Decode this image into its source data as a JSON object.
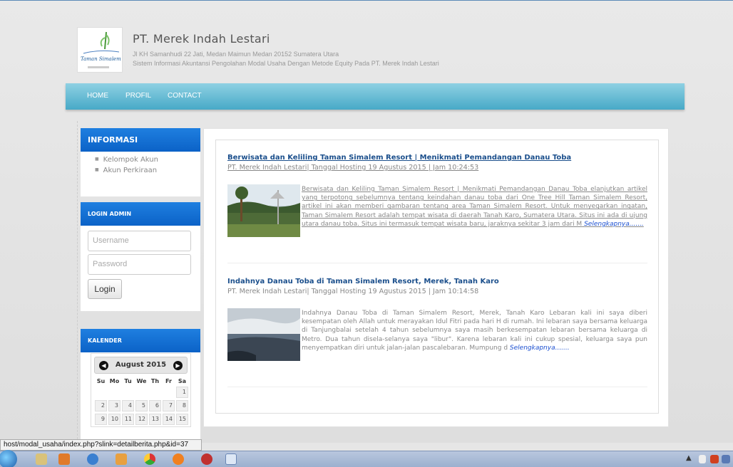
{
  "header": {
    "title": "PT. Merek Indah Lestari",
    "address": "Jl KH Samanhudi 22 Jati, Medan Maimun Medan 20152 Sumatera Utara",
    "description": "Sistem Informasi Akuntansi Pengolahan Modal Usaha Dengan Metode Equity Pada PT. Merek Indah Lestari",
    "logo_text": "Taman Simalem Resort"
  },
  "nav": {
    "items": [
      "HOME",
      "PROFIL",
      "CONTACT"
    ]
  },
  "sidebar": {
    "informasi": {
      "title": "INFORMASI",
      "items": [
        "Kelompok Akun",
        "Akun Perkiraan"
      ]
    },
    "login": {
      "title": "LOGIN ADMIN",
      "username_placeholder": "Username",
      "password_placeholder": "Password",
      "button": "Login"
    },
    "kalender": {
      "title": "KALENDER",
      "month": "August 2015",
      "weekdays": [
        "Su",
        "Mo",
        "Tu",
        "We",
        "Th",
        "Fr",
        "Sa"
      ],
      "week1": [
        "1"
      ],
      "week2": [
        "2",
        "3",
        "4",
        "5",
        "6",
        "7",
        "8"
      ],
      "week3": [
        "9",
        "10",
        "11",
        "12",
        "13",
        "14",
        "15"
      ]
    }
  },
  "articles": [
    {
      "title": "Berwisata dan Keliling Taman Simalem Resort | Menikmati Pemandangan Danau Toba",
      "meta": "PT. Merek Indah Lestari| Tanggal Hosting 19 Agustus 2015 | Jam 10:24:53",
      "body": "Berwisata dan Keliling Taman Simalem Resort | Menikmati Pemandangan Danau Toba elanjutkan artikel yang terpotong sebelumnya tentang keindahan danau toba dari One Tree Hill Taman Simalem Resort, artikel ini akan memberi gambaran tentang area Taman Simalem Resort. Untuk menyegarkan ingatan, Taman Simalem Resort adalah tempat wisata di daerah Tanah Karo, Sumatera Utara. Situs ini ada di ujung utara danau toba. Situs ini termasuk tempat wisata baru, jaraknya sekitar 3 jam dari M",
      "more": "Selengkapnya......."
    },
    {
      "title": "Indahnya Danau Toba di Taman Simalem Resort, Merek, Tanah Karo",
      "meta": "PT. Merek Indah Lestari| Tanggal Hosting 19 Agustus 2015 | Jam 10:14:58",
      "body": "Indahnya Danau Toba di Taman Simalem Resort, Merek, Tanah Karo Lebaran kali ini saya diberi kesempatan oleh Allah untuk merayakan Idul Fitri pada hari H di rumah. Ini lebaran saya bersama keluarga di Tanjungbalai setelah 4 tahun sebelumnya saya masih berkesempatan lebaran bersama keluarga di Metro. Dua tahun disela-selanya saya \"libur\". Karena lebaran kali ini cukup spesial, keluarga saya pun menyempatkan diri untuk jalan-jalan pascalebaran. Mumpung d",
      "more": "Selengkapnya......."
    }
  ],
  "status_bar": "host/modal_usaha/index.php?slink=detailberita.php&id=37",
  "colors": {
    "nav": "#5fb8d4",
    "sidebar_head": "#1070d8",
    "link": "#1b4f8c"
  }
}
